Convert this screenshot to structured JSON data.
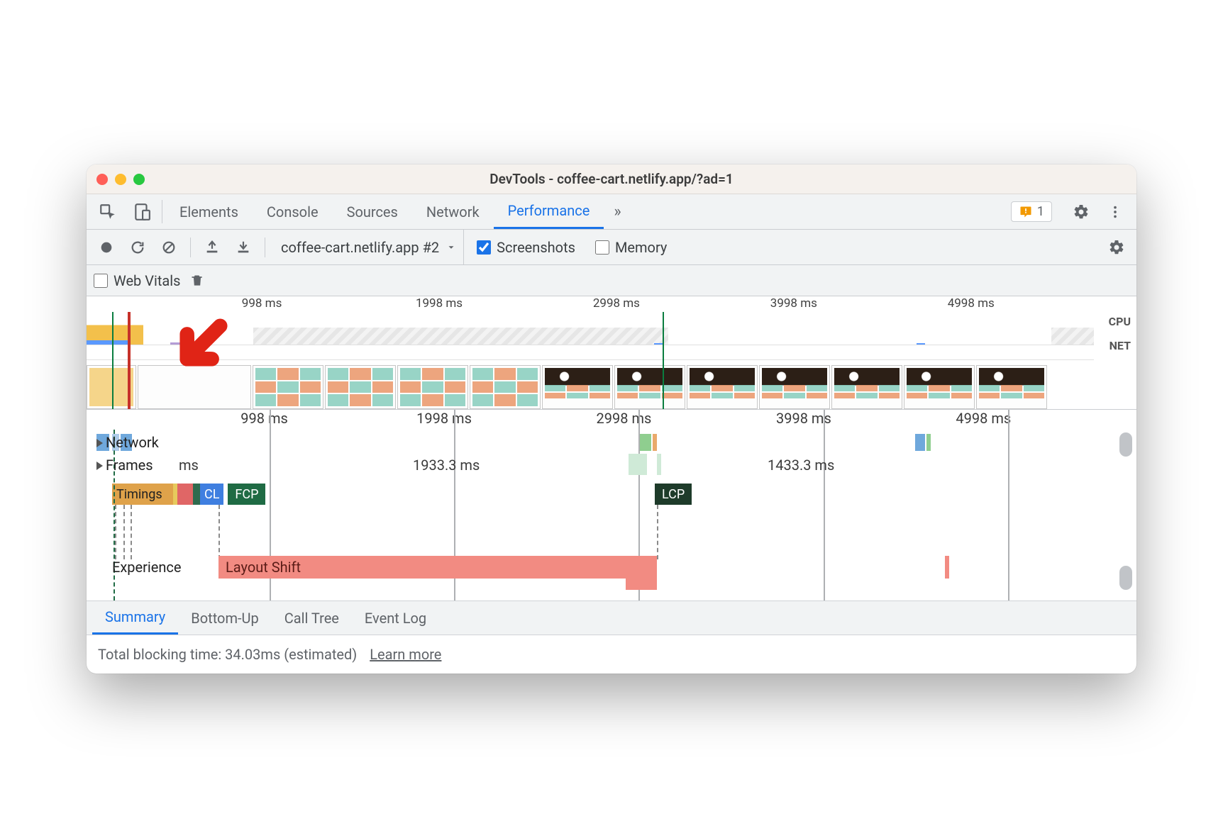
{
  "window": {
    "title": "DevTools - coffee-cart.netlify.app/?ad=1"
  },
  "tabs": {
    "items": [
      "Elements",
      "Console",
      "Sources",
      "Network",
      "Performance"
    ],
    "more": "»",
    "issues_count": "1"
  },
  "toolbar": {
    "recording_label": "coffee-cart.netlify.app #2",
    "screenshots_label": "Screenshots",
    "memory_label": "Memory",
    "screenshots_checked": true,
    "memory_checked": false
  },
  "web_vitals_row": {
    "label": "Web Vitals",
    "checked": false
  },
  "overview": {
    "ticks": [
      "998 ms",
      "1998 ms",
      "2998 ms",
      "3998 ms",
      "4998 ms"
    ],
    "tick_positions_pct": [
      17.4,
      35.0,
      52.6,
      70.2,
      87.8
    ],
    "cpu_label": "CPU",
    "net_label": "NET"
  },
  "flame": {
    "ticks": [
      "998 ms",
      "1998 ms",
      "2998 ms",
      "3998 ms",
      "4998 ms"
    ],
    "tick_positions_pct": [
      17.4,
      35.0,
      52.6,
      70.2,
      87.8
    ],
    "network_label": "Network",
    "frames_label": "Frames",
    "timings_label": "Timings",
    "experience_label": "Experience",
    "frames_values": [
      "ms",
      "1933.3 ms",
      "1433.3 ms"
    ],
    "timings": {
      "cl": "CL",
      "fcp": "FCP",
      "lcp": "LCP"
    },
    "layout_shift_label": "Layout Shift"
  },
  "bottom": {
    "tabs": [
      "Summary",
      "Bottom-Up",
      "Call Tree",
      "Event Log"
    ],
    "tbt_text": "Total blocking time: 34.03ms (estimated)",
    "learn_more": "Learn more"
  }
}
